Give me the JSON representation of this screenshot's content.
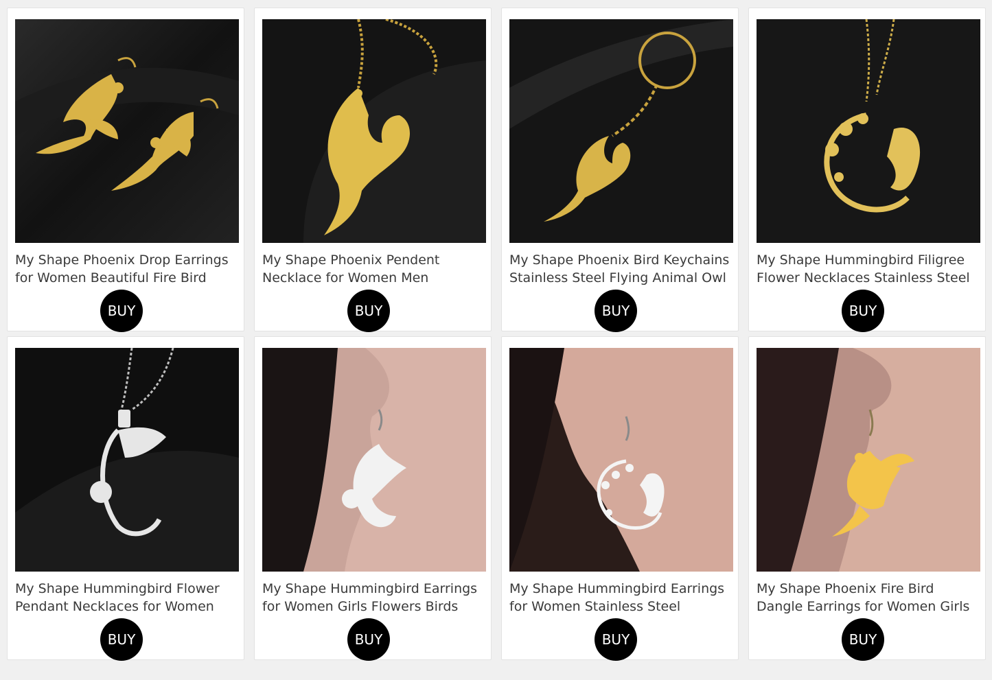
{
  "products": [
    {
      "title": "My Shape Phoenix Drop Earrings for Women Beautiful Fire Bird",
      "buy_label": "BUY",
      "image": "phoenix-earrings-gold",
      "metal": "#d9b347"
    },
    {
      "title": "My Shape Phoenix Pendent Necklace for Women Men",
      "buy_label": "BUY",
      "image": "phoenix-necklace-gold",
      "metal": "#e0bd4c"
    },
    {
      "title": "My Shape Phoenix Bird Keychains Stainless Steel Flying Animal Owl",
      "buy_label": "BUY",
      "image": "phoenix-keychain-gold",
      "metal": "#d8b449"
    },
    {
      "title": "My Shape Hummingbird Filigree Flower Necklaces Stainless Steel",
      "buy_label": "BUY",
      "image": "hummingbird-flower-necklace-gold",
      "metal": "#e2c15a"
    },
    {
      "title": "My Shape Hummingbird Flower Pendant Necklaces for Women",
      "buy_label": "BUY",
      "image": "hummingbird-necklace-silver",
      "metal": "#e6e6e6"
    },
    {
      "title": "My Shape Hummingbird Earrings for Women Girls Flowers Birds",
      "buy_label": "BUY",
      "image": "hummingbird-earring-silver-on-ear",
      "metal": "#f2f2f2"
    },
    {
      "title": "My Shape Hummingbird Earrings for Women Stainless Steel",
      "buy_label": "BUY",
      "image": "hummingbird-wreath-earring-silver-on-ear",
      "metal": "#f4f4f4"
    },
    {
      "title": "My Shape Phoenix Fire Bird Dangle Earrings for Women Girls",
      "buy_label": "BUY",
      "image": "phoenix-earring-gold-on-ear",
      "metal": "#f3c44a"
    }
  ],
  "colors": {
    "buy_button": "#000000",
    "buy_text": "#ffffff",
    "page_bg": "#f0f0f0",
    "card_bg": "#ffffff"
  }
}
